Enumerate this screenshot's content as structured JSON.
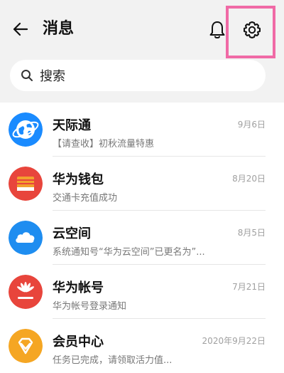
{
  "header": {
    "title": "消息",
    "back_icon": "back-arrow-icon",
    "bell_icon": "bell-icon",
    "settings_icon": "settings-icon",
    "highlight_color": "#f06aa6"
  },
  "search": {
    "placeholder": "搜索",
    "icon": "search-icon"
  },
  "messages": [
    {
      "title": "天际通",
      "preview": "【请查收】初秋流量特惠",
      "date": "9月6日",
      "icon": "globe-icon",
      "color": "#1a8bff"
    },
    {
      "title": "华为钱包",
      "preview": "交通卡充值成功",
      "date": "8月20日",
      "icon": "wallet-icon",
      "color": "#e8453c"
    },
    {
      "title": "云空间",
      "preview": "系统通知号“华为云空间”已更名为”...",
      "date": "8月5日",
      "icon": "cloud-icon",
      "color": "#1e8df0"
    },
    {
      "title": "华为帐号",
      "preview": "华为帐号登录通知",
      "date": "7月21日",
      "icon": "huawei-logo-icon",
      "color": "#e8453c"
    },
    {
      "title": "会员中心",
      "preview": "任务已完成，请领取活力值...",
      "date": "2020年9月22日",
      "icon": "diamond-icon",
      "color": "#f5a623"
    }
  ]
}
